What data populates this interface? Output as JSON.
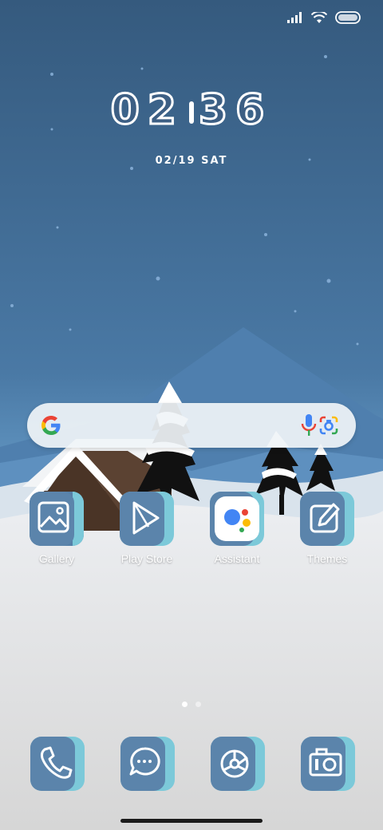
{
  "status": {
    "signal_icon": "signal-icon",
    "wifi_icon": "wifi-icon",
    "battery_icon": "battery-icon"
  },
  "clock": {
    "time": "02:36",
    "time_hours": "02",
    "time_minutes": "36",
    "date": "02/19 SAT"
  },
  "search": {
    "google_icon": "google-logo-icon",
    "mic_icon": "mic-icon",
    "lens_icon": "lens-icon"
  },
  "apps": [
    {
      "label": "Gallery",
      "icon": "gallery-icon"
    },
    {
      "label": "Play Store",
      "icon": "play-store-icon"
    },
    {
      "label": "Assistant",
      "icon": "assistant-icon"
    },
    {
      "label": "Themes",
      "icon": "themes-icon"
    }
  ],
  "dock": [
    {
      "icon": "phone-icon"
    },
    {
      "icon": "messages-icon"
    },
    {
      "icon": "browser-icon"
    },
    {
      "icon": "camera-icon"
    }
  ],
  "pages": {
    "count": 2,
    "active": 1
  },
  "colors": {
    "tile_blue": "#5b84ab",
    "tile_accent": "#7cc9d9",
    "sky_top": "#375b80",
    "sky_bottom": "#6b9cc8",
    "snow": "#e4e6ea"
  }
}
